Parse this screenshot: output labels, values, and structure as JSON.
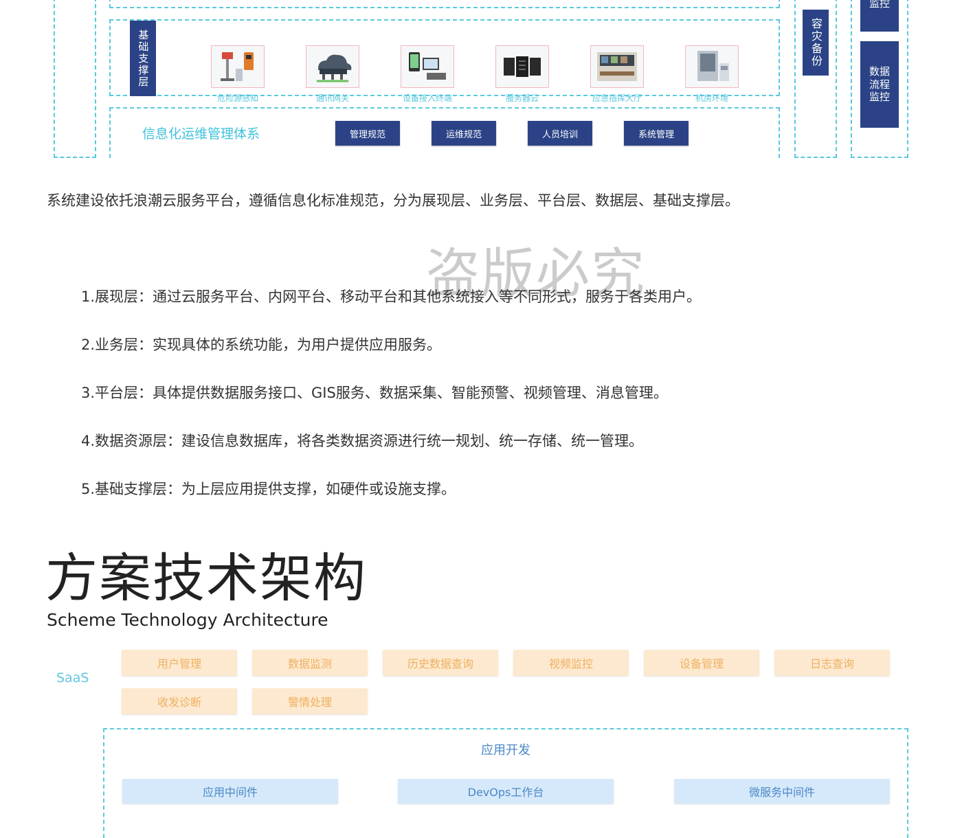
{
  "diagram": {
    "infra_layer": {
      "label": "基础支撑层",
      "devices": [
        {
          "caption": "危险源感知",
          "icon": "sensor-icon"
        },
        {
          "caption": "通讯网关",
          "icon": "cloud-gateway-icon"
        },
        {
          "caption": "设备接入终端",
          "icon": "terminal-devices-icon"
        },
        {
          "caption": "服务器云",
          "icon": "server-rack-icon"
        },
        {
          "caption": "应急指挥大厅",
          "icon": "command-hall-icon"
        },
        {
          "caption": "机房环境",
          "icon": "server-cabinet-icon"
        }
      ]
    },
    "ops_system": {
      "title": "信息化运维管理体系",
      "buttons": [
        "管理规范",
        "运维规范",
        "人员培训",
        "系统管理"
      ]
    },
    "disaster_backup": "容灾备份",
    "right_top_label": "监控",
    "data_flow_monitor": "数据流程监控"
  },
  "intro": "系统建设依托浪潮云服务平台，遵循信息化标准规范，分为展现层、业务层、平台层、数据层、基础支撑层。",
  "watermark": "盗版必究",
  "layers": [
    "1.展现层：通过云服务平台、内网平台、移动平台和其他系统接入等不同形式，服务于各类用户。",
    "2.业务层：实现具体的系统功能，为用户提供应用服务。",
    "3.平台层：具体提供数据服务接口、GIS服务、数据采集、智能预警、视频管理、消息管理。",
    "4.数据资源层：建设信息数据库，将各类数据资源进行统一规划、统一存储、统一管理。",
    "5.基础支撑层：为上层应用提供支撑，如硬件或设施支撑。"
  ],
  "section": {
    "title": "方案技术架构",
    "subtitle": "Scheme Technology Architecture"
  },
  "arch": {
    "saas_label": "SaaS",
    "saas_items": [
      "用户管理",
      "数据监测",
      "历史数据查询",
      "视频监控",
      "设备管理",
      "日志查询",
      "收发诊断",
      "警情处理"
    ],
    "app_dev": {
      "title": "应用开发",
      "items": [
        "应用中间件",
        "DevOps工作台",
        "微服务中间件"
      ]
    }
  },
  "colors": {
    "dashed": "#59c9dc",
    "navy": "#2b4386",
    "saas_bg": "#fde9cf",
    "saas_text": "#efb061",
    "mw_bg": "#d6e9fb",
    "mw_text": "#4a88c6"
  }
}
